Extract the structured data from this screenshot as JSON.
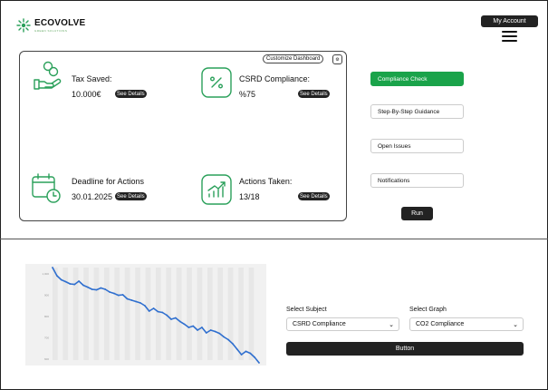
{
  "brand": {
    "name": "ECOVOLVE",
    "tagline": "GREEN SOLUTIONS"
  },
  "header": {
    "account_label": "My Account"
  },
  "dashboard": {
    "customize_label": "Customize Dashboard",
    "metrics": [
      {
        "title": "Tax Saved:",
        "value": "10.000€",
        "details": "See Details"
      },
      {
        "title": "CSRD Compliance:",
        "value": "%75",
        "details": "See Details"
      },
      {
        "title": "Deadline for Actions",
        "value": "30.01.2025",
        "details": "See Details"
      },
      {
        "title": "Actions Taken:",
        "value": "13/18",
        "details": "See Details"
      }
    ]
  },
  "sidebar": {
    "items": [
      {
        "label": "Compliance Check"
      },
      {
        "label": "Step-By-Step Guidance"
      },
      {
        "label": "Open Issues"
      },
      {
        "label": "Notifications"
      }
    ],
    "run_label": "Run"
  },
  "controls": {
    "subject_label": "Select Subject",
    "subject_value": "CSRD Compliance",
    "graph_label": "Select Graph",
    "graph_value": "CO2 Compliance",
    "button_label": "Button"
  },
  "colors": {
    "accent": "#1aa34a",
    "line": "#2f6fcf",
    "dark": "#222222"
  },
  "chart_data": {
    "type": "line",
    "ylim": [
      680,
      1020
    ],
    "y_ticks": [
      "1,000",
      "900",
      "800",
      "700",
      "600"
    ],
    "series": [
      {
        "values": [
          1020,
          990,
          975,
          968,
          960,
          958,
          970,
          955,
          948,
          940,
          938,
          945,
          940,
          930,
          925,
          918,
          920,
          905,
          900,
          895,
          890,
          880,
          860,
          870,
          858,
          855,
          845,
          830,
          835,
          822,
          812,
          800,
          805,
          790,
          800,
          780,
          790,
          785,
          778,
          765,
          755,
          740,
          720,
          700,
          712,
          705,
          690,
          670
        ]
      }
    ]
  }
}
